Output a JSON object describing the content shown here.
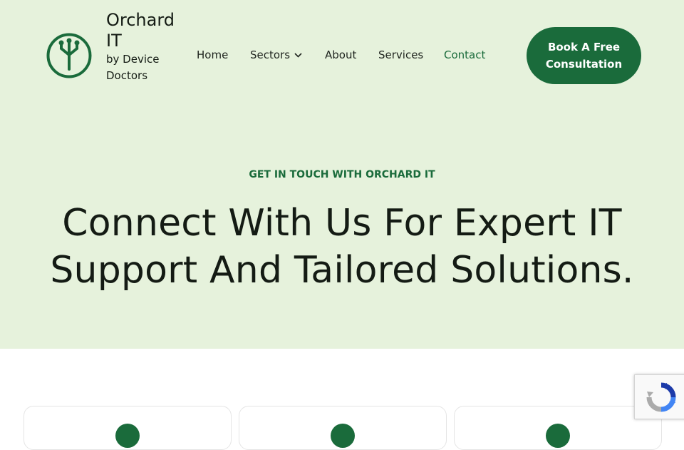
{
  "brand": {
    "name": "Orchard IT",
    "tagline": "by Device Doctors",
    "logo_icon": "tree-circle-icon",
    "accent_color": "#1a6b3b",
    "hero_background": "#e6f2dc"
  },
  "nav": {
    "items": [
      {
        "label": "Home"
      },
      {
        "label": "Sectors",
        "has_dropdown": true
      },
      {
        "label": "About"
      },
      {
        "label": "Services"
      },
      {
        "label": "Contact",
        "active": true
      }
    ]
  },
  "cta": {
    "label": "Book A Free Consultation"
  },
  "hero": {
    "eyebrow": "GET IN TOUCH WITH ORCHARD IT",
    "headline": "Connect With Us For Expert IT Support And Tailored Solutions."
  },
  "cards": [
    {
      "icon": "circle-icon"
    },
    {
      "icon": "circle-icon"
    },
    {
      "icon": "circle-icon"
    }
  ],
  "recaptcha": {
    "icon": "recaptcha-icon"
  }
}
